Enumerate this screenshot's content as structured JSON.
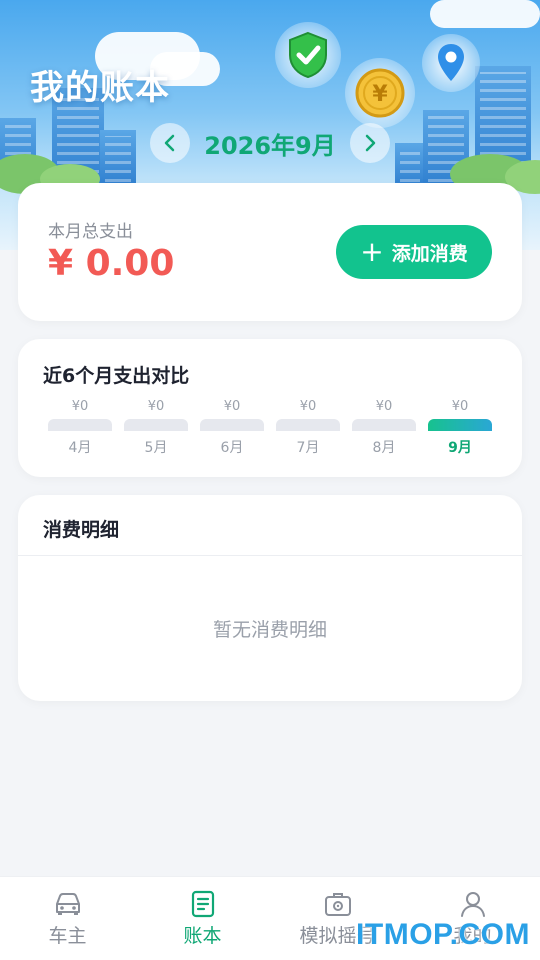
{
  "header": {
    "title": "我的账本",
    "month": "2026年9月"
  },
  "summary": {
    "label": "本月总支出",
    "amount": "¥ 0.00",
    "add_button": "添加消费"
  },
  "compare": {
    "title": "近6个月支出对比",
    "months": [
      {
        "value": "¥0",
        "label": "4月",
        "active": false
      },
      {
        "value": "¥0",
        "label": "5月",
        "active": false
      },
      {
        "value": "¥0",
        "label": "6月",
        "active": false
      },
      {
        "value": "¥0",
        "label": "7月",
        "active": false
      },
      {
        "value": "¥0",
        "label": "8月",
        "active": false
      },
      {
        "value": "¥0",
        "label": "9月",
        "active": true
      }
    ]
  },
  "detail": {
    "title": "消费明细",
    "empty_text": "暂无消费明细"
  },
  "tabbar": {
    "items": [
      {
        "label": "车主",
        "icon": "car-icon"
      },
      {
        "label": "账本",
        "icon": "ledger-icon"
      },
      {
        "label": "模拟摇号",
        "icon": "lottery-icon"
      },
      {
        "label": "我的",
        "icon": "user-icon"
      }
    ],
    "active_index": 1
  },
  "watermark": "ITMOP.COM",
  "colors": {
    "accent": "#12c38e",
    "accent_text": "#10a775",
    "amount": "#f25a55"
  }
}
